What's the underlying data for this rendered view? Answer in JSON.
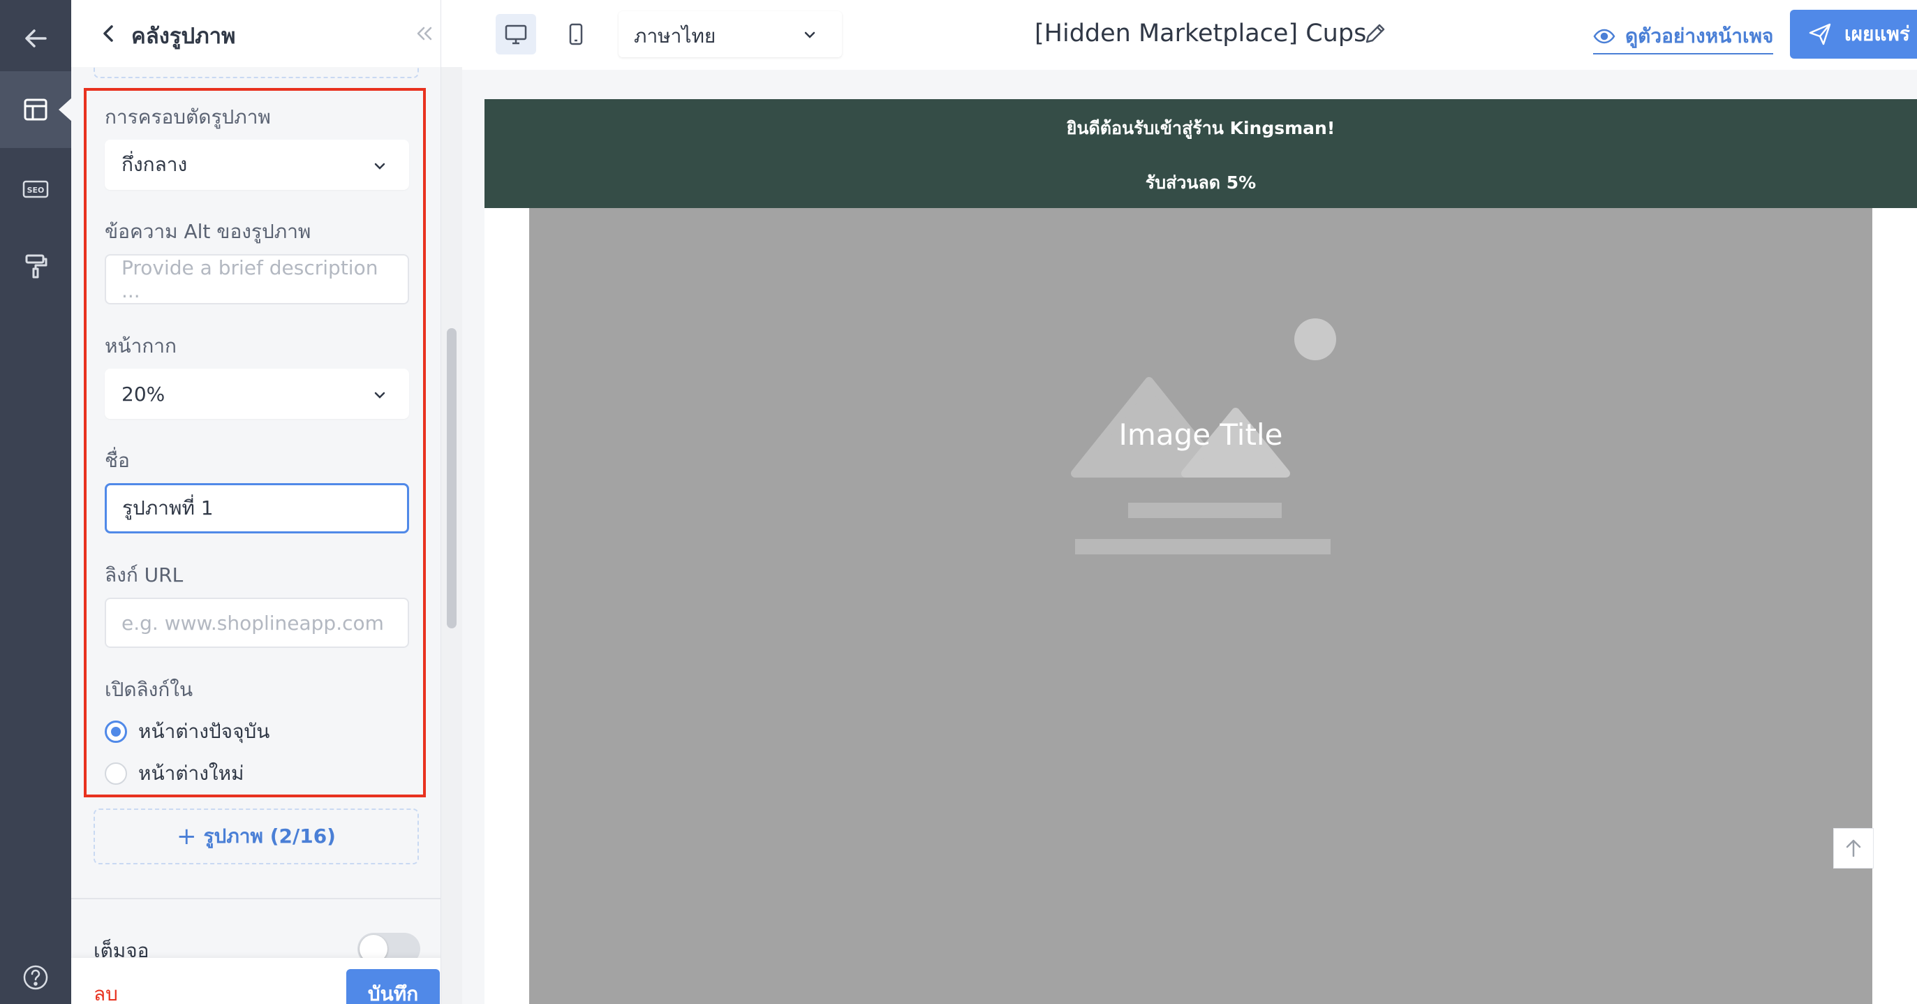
{
  "rail": {
    "items": [
      "back-arrow-icon",
      "layout-icon",
      "seo-icon",
      "paint-roller-icon",
      "help-icon"
    ],
    "seo_text": "SEO"
  },
  "panel": {
    "title": "คลังรูปภาพ",
    "crop": {
      "label": "การครอบตัดรูปภาพ",
      "value": "กึ่งกลาง"
    },
    "alt": {
      "label": "ข้อความ Alt ของรูปภาพ",
      "placeholder": "Provide a brief description ..."
    },
    "mask": {
      "label": "หน้ากาก",
      "value": "20%"
    },
    "name": {
      "label": "ชื่อ",
      "value": "รูปภาพที่ 1"
    },
    "link": {
      "label": "ลิงก์ URL",
      "placeholder": "e.g. www.shoplineapp.com"
    },
    "open_in": {
      "label": "เปิดลิงก์ใน",
      "options": [
        "หน้าต่างปัจจุบัน",
        "หน้าต่างใหม่"
      ],
      "selected": 0
    },
    "add_image": "รูปภาพ (2/16)",
    "fullscreen": {
      "label": "เต็มจอ",
      "on": false
    },
    "delete_label": "ลบ",
    "save_label": "บันทึก"
  },
  "topbar": {
    "language": "ภาษาไทย",
    "page_title": "[Hidden Marketplace] Cups",
    "preview_label": "ดูตัวอย่างหน้าเพจ",
    "publish_label": "เผยแพร่"
  },
  "canvas": {
    "announcement_1": "ยินดีต้อนรับเข้าสู่ร้าน Kingsman!",
    "announcement_2": "รับส่วนลด 5%",
    "image_title": "Image Title"
  },
  "colors": {
    "accent": "#5089e8",
    "highlight": "#e8321f",
    "rail": "#3b4252",
    "announcement_bg": "#354d47",
    "hero_bg": "#a3a3a3"
  }
}
